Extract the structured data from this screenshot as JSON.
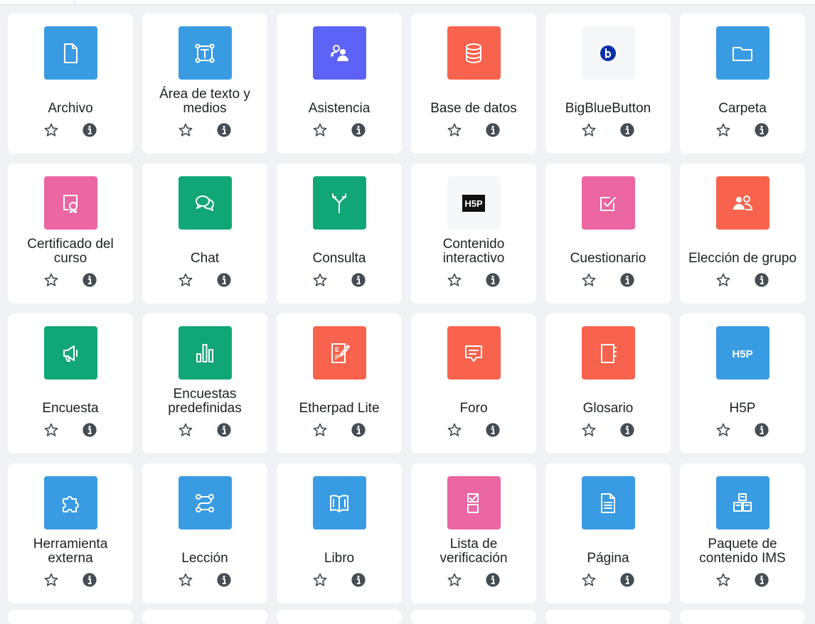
{
  "colors": {
    "blue": "#399be2",
    "purple": "#5d63f6",
    "red": "#f7634d",
    "green": "#11a676",
    "pink": "#eb66a2",
    "grey": "#f5f7f9",
    "bbb": "#0a2ea4",
    "text": "#1d2125",
    "action_icon": "#444c54"
  },
  "actions": {
    "star_icon": "star-outline-icon",
    "info_icon": "info-circle-icon"
  },
  "modules": [
    {
      "label": "Archivo",
      "icon": "file-icon",
      "color": "blue"
    },
    {
      "label": "Área de texto y medios",
      "icon": "text-frame-icon",
      "color": "blue"
    },
    {
      "label": "Asistencia",
      "icon": "attendance-users-icon",
      "color": "purple"
    },
    {
      "label": "Base de datos",
      "icon": "database-icon",
      "color": "red"
    },
    {
      "label": "BigBlueButton",
      "icon": "bigbluebutton-logo-icon",
      "color": "grey"
    },
    {
      "label": "Carpeta",
      "icon": "folder-icon",
      "color": "blue"
    },
    {
      "label": "Certificado del curso",
      "icon": "certificate-icon",
      "color": "pink"
    },
    {
      "label": "Chat",
      "icon": "chat-bubbles-icon",
      "color": "green"
    },
    {
      "label": "Consulta",
      "icon": "split-arrows-icon",
      "color": "green"
    },
    {
      "label": "Contenido interactivo",
      "icon": "h5p-logo-icon",
      "color": "grey"
    },
    {
      "label": "Cuestionario",
      "icon": "checkbox-quiz-icon",
      "color": "pink"
    },
    {
      "label": "Elección de grupo",
      "icon": "group-choice-icon",
      "color": "red"
    },
    {
      "label": "Encuesta",
      "icon": "megaphone-icon",
      "color": "green"
    },
    {
      "label": "Encuestas predefinidas",
      "icon": "bar-chart-icon",
      "color": "green"
    },
    {
      "label": "Etherpad Lite",
      "icon": "etherpad-icon",
      "color": "red"
    },
    {
      "label": "Foro",
      "icon": "forum-bubble-icon",
      "color": "red"
    },
    {
      "label": "Glosario",
      "icon": "glossary-book-icon",
      "color": "red"
    },
    {
      "label": "H5P",
      "icon": "h5p-icon",
      "color": "blue"
    },
    {
      "label": "Herramienta externa",
      "icon": "puzzle-piece-icon",
      "color": "blue"
    },
    {
      "label": "Lección",
      "icon": "lesson-path-icon",
      "color": "blue"
    },
    {
      "label": "Libro",
      "icon": "open-book-icon",
      "color": "blue"
    },
    {
      "label": "Lista de verificación",
      "icon": "checklist-icon",
      "color": "pink"
    },
    {
      "label": "Página",
      "icon": "page-document-icon",
      "color": "blue"
    },
    {
      "label": "Paquete de contenido IMS",
      "icon": "ims-package-icon",
      "color": "blue"
    }
  ]
}
